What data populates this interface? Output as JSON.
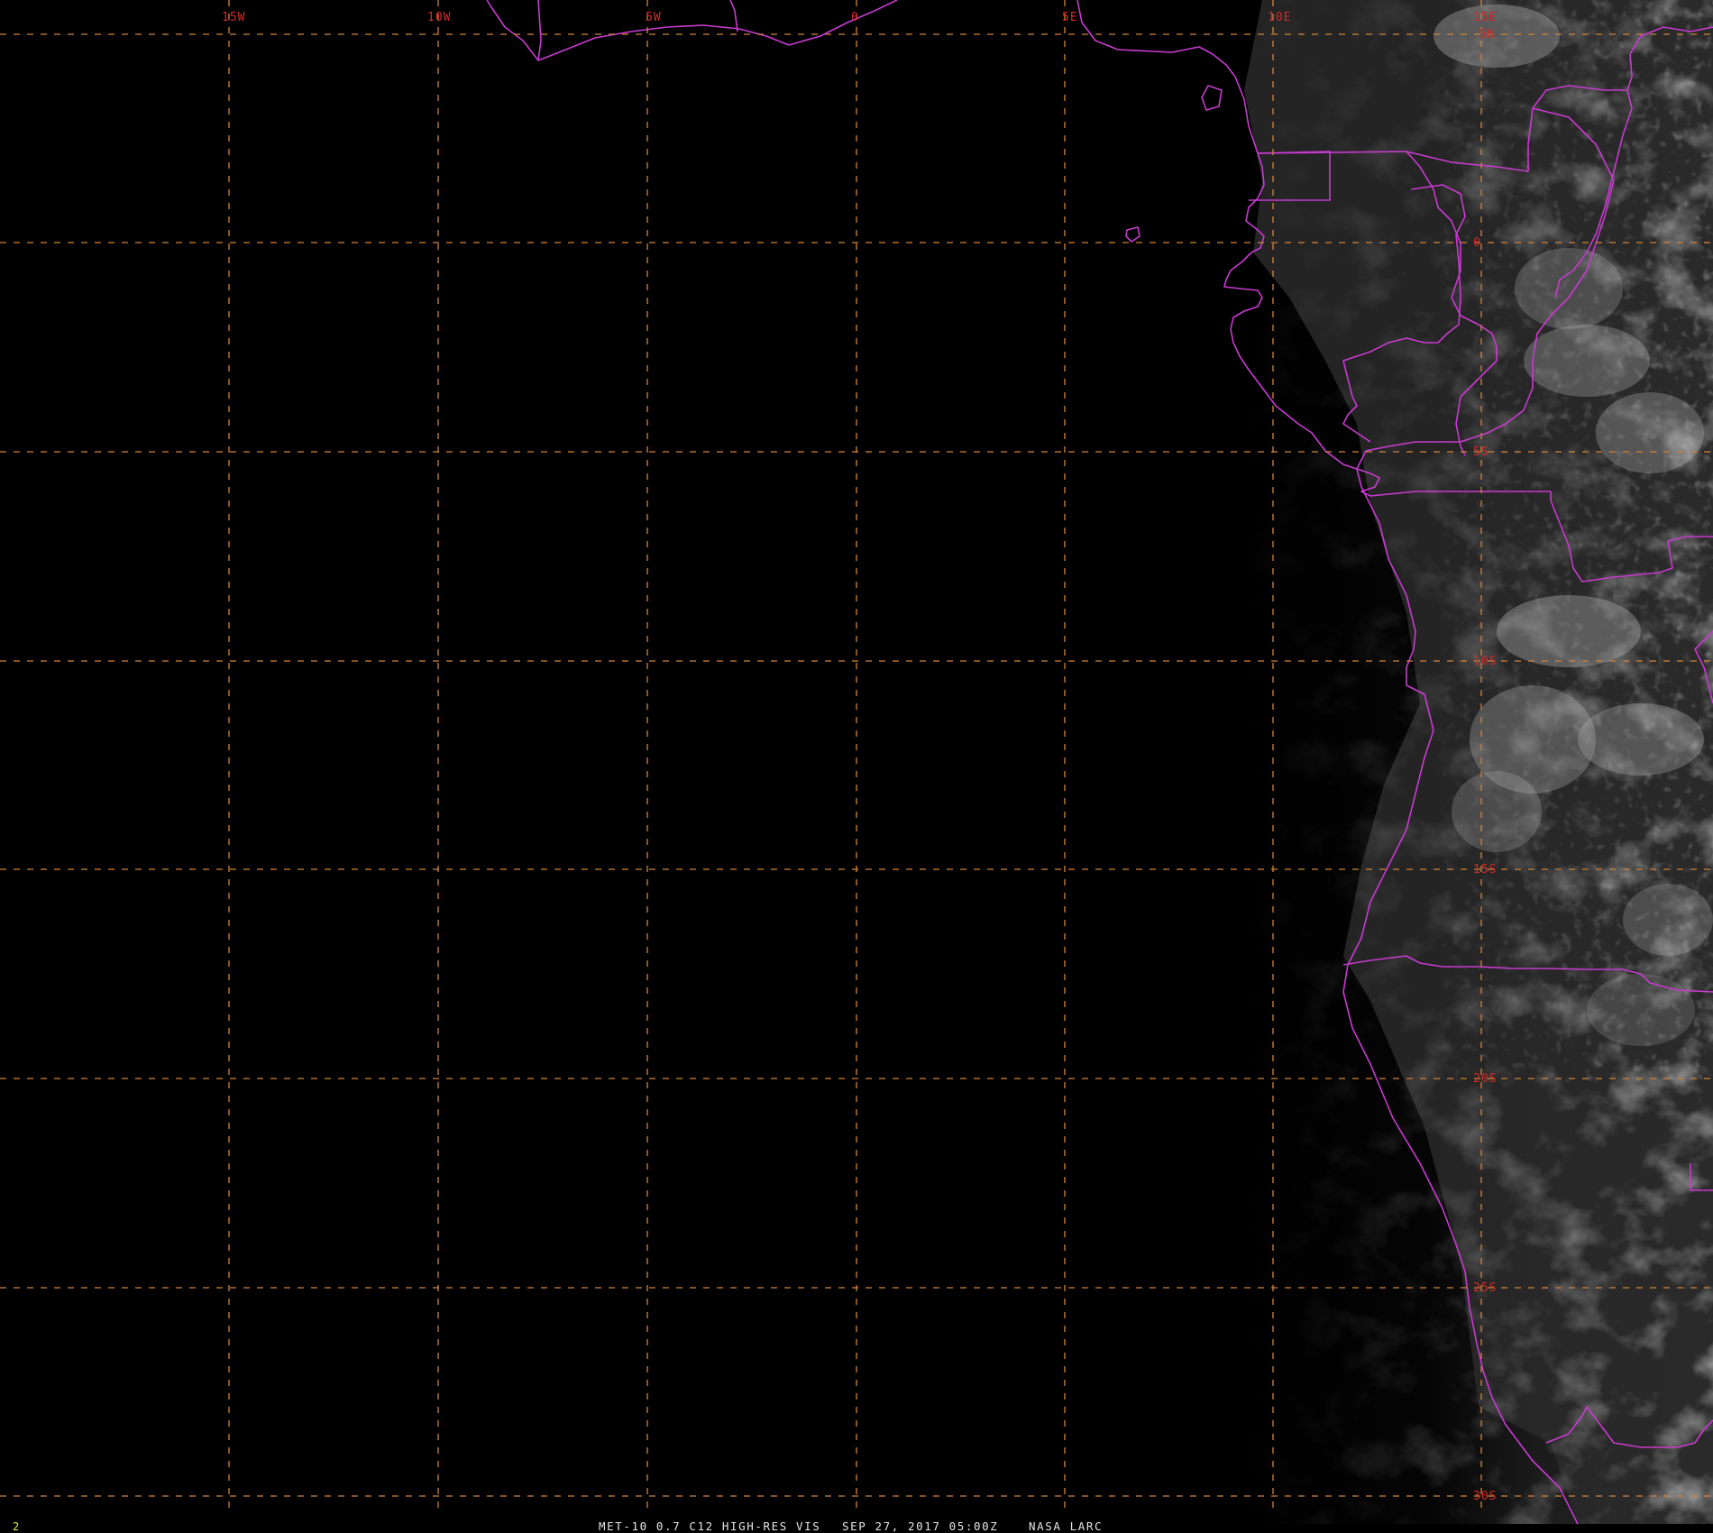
{
  "caption": {
    "frame_number": "2",
    "product": "MET-10 0.7 C12 HIGH-RES VIS",
    "datetime": "SEP 27, 2017 05:00Z",
    "source": "NASA LARC"
  },
  "longitude_labels": [
    "15W",
    "10W",
    "5W",
    "0",
    "5E",
    "10E",
    "15E"
  ],
  "latitude_labels": [
    "5N",
    "0",
    "5S",
    "10S",
    "15S",
    "20S",
    "25S",
    "30S"
  ],
  "colors": {
    "background": "#000000",
    "graticule": "#d0843c",
    "grid_labels": "#d22a2a",
    "political_borders": "#c83bd0",
    "caption_text": "#e6e6e6",
    "frame_number": "#e7e94a"
  },
  "layers": {
    "imagery": "visible-satellite-cloud-imagery",
    "graticule_style": "dashed",
    "borders": "political-boundaries"
  }
}
